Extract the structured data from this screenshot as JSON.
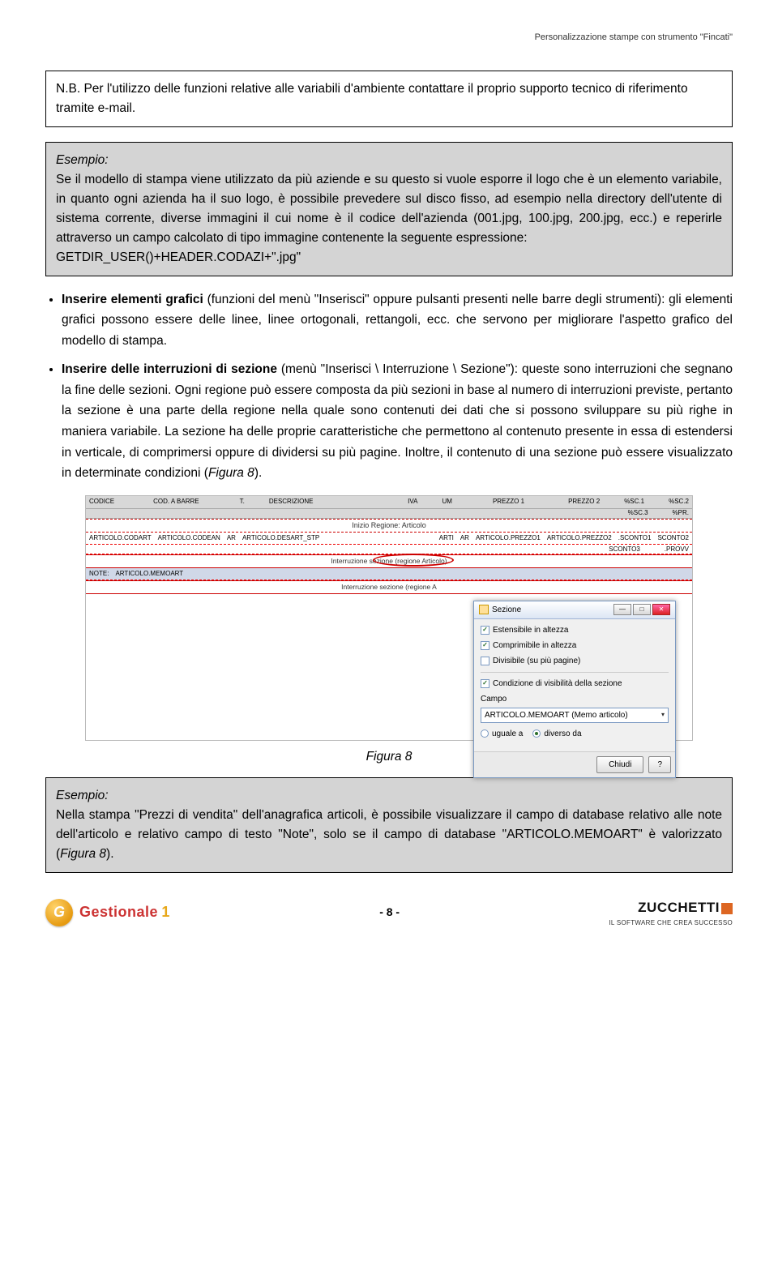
{
  "header": {
    "title": "Personalizzazione stampe con strumento \"Fincati\""
  },
  "nb": {
    "text": "N.B. Per l'utilizzo delle funzioni relative alle variabili d'ambiente contattare il proprio supporto tecnico di riferimento tramite e-mail."
  },
  "esempio1": {
    "label": "Esempio:",
    "text": "Se il modello di stampa viene utilizzato da più aziende e su questo si vuole esporre il logo che è un elemento variabile, in quanto ogni azienda ha il suo logo, è possibile prevedere sul disco fisso, ad esempio nella directory dell'utente di sistema corrente, diverse immagini il cui nome è il codice dell'azienda (001.jpg, 100.jpg, 200.jpg, ecc.) e reperirle attraverso un campo calcolato di tipo immagine contenente la seguente espressione:",
    "code": "GETDIR_USER()+HEADER.CODAZI+\".jpg\""
  },
  "bullets": {
    "item1_bold": "Inserire elementi grafici",
    "item1_rest": " (funzioni del menù \"Inserisci\" oppure pulsanti presenti nelle barre degli strumenti): gli elementi grafici possono essere delle linee, linee ortogonali, rettangoli, ecc. che servono per migliorare l'aspetto grafico del modello di stampa.",
    "item2_bold": "Inserire delle interruzioni di sezione",
    "item2_rest": " (menù \"Inserisci \\ Interruzione \\ Sezione\"): queste sono interruzioni che segnano la fine delle sezioni. Ogni regione può essere composta da più sezioni in base al numero di interruzioni previste, pertanto la sezione è una parte della regione nella quale sono contenuti dei dati che si possono sviluppare su più righe in maniera variabile. La sezione ha delle proprie caratteristiche che permettono al contenuto presente in essa di estendersi in verticale, di comprimersi oppure di dividersi su più pagine. Inoltre, il contenuto di una sezione può essere visualizzato in determinate condizioni (",
    "item2_fig": "Figura 8",
    "item2_end": ")."
  },
  "screenshot": {
    "header_cells": [
      "CODICE",
      "COD. A BARRE",
      "T.",
      "DESCRIZIONE",
      "IVA",
      "UM",
      "PREZZO 1",
      "PREZZO 2",
      "%SC.1",
      "%SC.2"
    ],
    "header_cells2": [
      "%SC.3",
      "%PR."
    ],
    "region_start": "Inizio Regione: Articolo",
    "row_cells": [
      "ARTICOLO.CODART",
      "ARTICOLO.CODEAN",
      "AR",
      "ARTICOLO.DESART_STP",
      "ARTI",
      "AR",
      "ARTICOLO.PREZZO1",
      "ARTICOLO.PREZZO2",
      ".SCONTO1",
      "SCONTO2"
    ],
    "row_cells2": [
      "SCONTO3",
      ".PROVV"
    ],
    "note_label": "NOTE:",
    "note_field": "ARTICOLO.MEMOART",
    "section1": "Interruzione sezione (regione Articolo)",
    "section2": "Interruzione sezione (regione A",
    "dialog": {
      "title": "Sezione",
      "chk1": "Estensibile in altezza",
      "chk2": "Comprimibile in altezza",
      "chk3": "Divisibile (su più pagine)",
      "chk4": "Condizione di visibilità della sezione",
      "field_label": "Campo",
      "field_value": "ARTICOLO.MEMOART (Memo articolo)",
      "radio1": "uguale a",
      "radio2": "diverso da",
      "btn_close": "Chiudi",
      "btn_help": "?"
    }
  },
  "figure_caption": "Figura 8",
  "esempio2": {
    "label": "Esempio:",
    "text": "Nella stampa \"Prezzi di vendita\" dell'anagrafica articoli, è possibile visualizzare il campo di database relativo alle note dell'articolo e relativo campo di testo \"Note\", solo se il campo di database \"ARTICOLO.MEMOART\" è valorizzato (",
    "fig": "Figura 8",
    "end": ")."
  },
  "footer": {
    "logo_text": "Gestionale",
    "logo_one": "1",
    "page": "- 8 -",
    "brand": "ZUCCHETTI",
    "tagline": "IL SOFTWARE CHE CREA SUCCESSO"
  }
}
